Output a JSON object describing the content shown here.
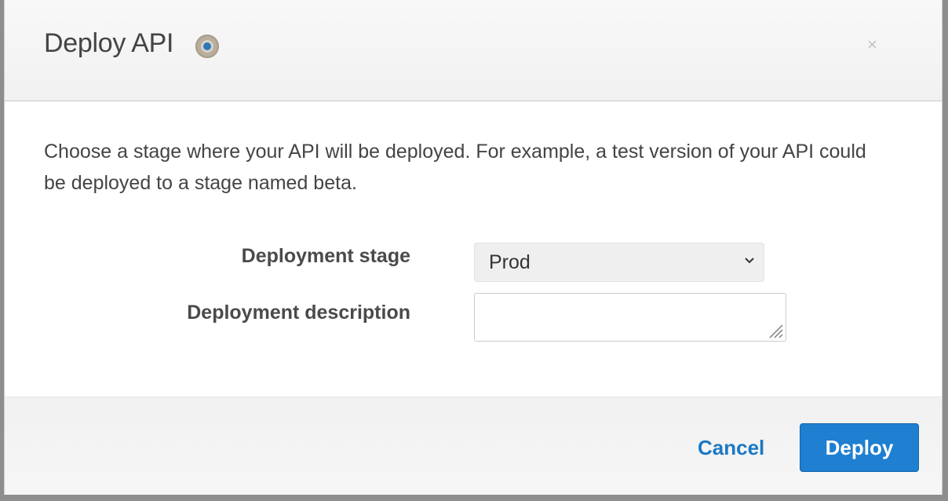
{
  "dialog": {
    "title": "Deploy API",
    "close_label": "×"
  },
  "body": {
    "intro_text": "Choose a stage where your API will be deployed. For example, a test version of your API could be deployed to a stage named beta.",
    "stage_label": "Deployment stage",
    "stage_value": "Prod",
    "description_label": "Deployment description",
    "description_value": ""
  },
  "footer": {
    "cancel_label": "Cancel",
    "deploy_label": "Deploy"
  },
  "colors": {
    "accent": "#1f7fd1",
    "link": "#1b78c4",
    "info_icon_inner": "#2a78b8"
  },
  "icons": {
    "title_icon": "info-circle-icon",
    "close": "close-icon",
    "select_arrow": "chevron-down-icon",
    "textarea_resize": "resize-handle-icon"
  }
}
